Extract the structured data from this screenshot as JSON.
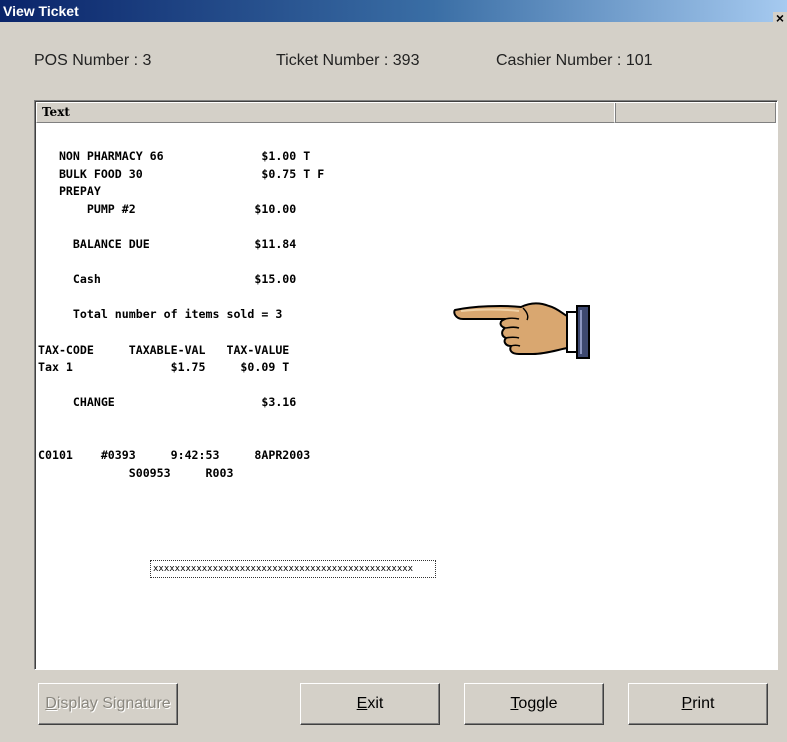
{
  "window": {
    "title": "View Ticket",
    "close_glyph": "×"
  },
  "info": {
    "pos": "POS Number : 3",
    "ticket": "Ticket Number : 393",
    "cashier": "Cashier Number : 101"
  },
  "list": {
    "column_header": "Text"
  },
  "receipt_lines": [
    "   NON PHARMACY 66              $1.00 T",
    "   BULK FOOD 30                 $0.75 T F",
    "   PREPAY",
    "       PUMP #2                 $10.00",
    "",
    "     BALANCE DUE               $11.84",
    "",
    "     Cash                      $15.00",
    "",
    "     Total number of items sold = 3",
    "",
    "TAX-CODE     TAXABLE-VAL   TAX-VALUE",
    "Tax 1              $1.75     $0.09 T",
    "",
    "     CHANGE                     $3.16",
    "",
    "",
    "C0101    #0393     9:42:53     8APR2003",
    "             S00953     R003"
  ],
  "signature_line": "xxxxxxxxxxxxxxxxxxxxxxxxxxxxxxxxxxxxxxxxxxxxxxxx",
  "buttons": {
    "display_signature": {
      "label": "Display Signature",
      "mnemonic": "D",
      "rest": "isplay Signature",
      "enabled": false
    },
    "exit": {
      "label": "Exit",
      "mnemonic": "E",
      "rest": "xit",
      "enabled": true
    },
    "toggle": {
      "label": "Toggle",
      "mnemonic": "T",
      "rest": "oggle",
      "enabled": true
    },
    "print": {
      "label": "Print",
      "mnemonic": "P",
      "rest": "rint",
      "enabled": true
    }
  },
  "icons": {
    "pointer": "pointing-hand-icon",
    "close": "close-icon"
  },
  "colors": {
    "title_bar_start": "#0a246a",
    "title_bar_end": "#a6caf0",
    "window_bg": "#d4d0c8",
    "disabled_text": "#8a877f"
  }
}
